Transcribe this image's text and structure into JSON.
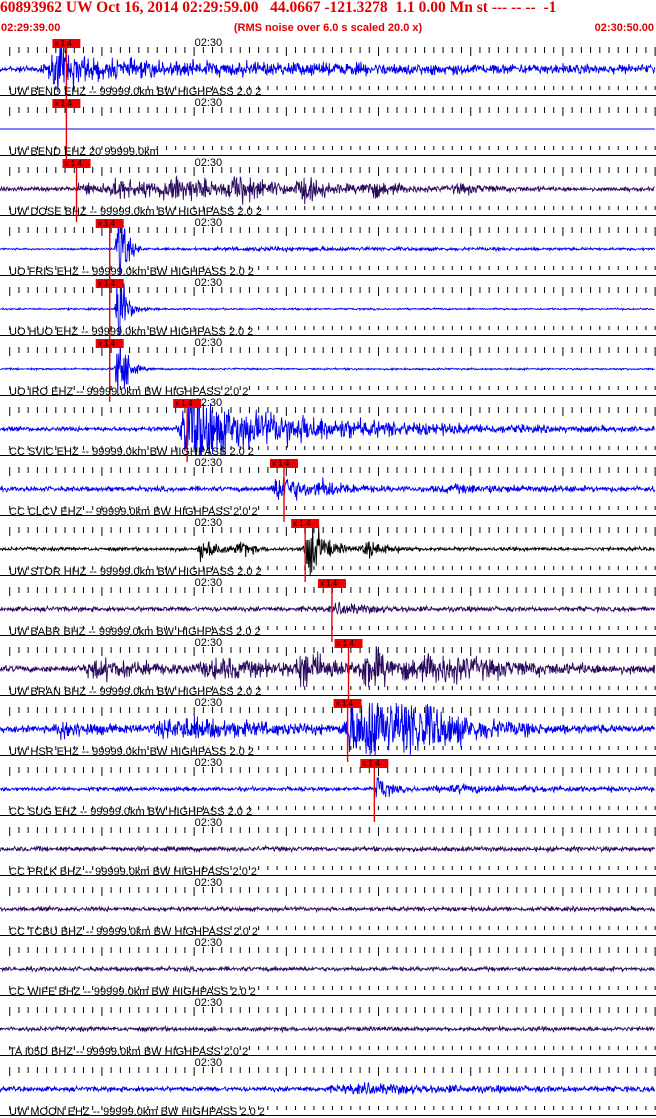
{
  "header": {
    "title": "60893962 UW Oct 16, 2014 02:29:59.00   44.0667 -121.3278  1.1 0.00 Mn st --- -- --  -1",
    "start_time": "02:29:39.00",
    "rms_note": "(RMS noise over 6.0 s scaled 20.0 x)",
    "end_time": "02:30:50.00"
  },
  "colors": {
    "header_red": "#e00000",
    "pick_red": "#ee0000",
    "trace_blue": "#0000ee",
    "trace_purple": "#2a0a5e",
    "trace_black": "#000000"
  },
  "chart_data": {
    "type": "seismogram",
    "x_axis": {
      "unit": "seconds since 02:29:39.00",
      "range": [
        0,
        71
      ],
      "tick_label": "02:30",
      "tick_label_x": 21
    },
    "pick_label": "x 1.4",
    "traces": [
      {
        "label": "UW BEND EHZ -- 99999.0km BW  HIGHPASS  2.0  2",
        "color": "#0000ee",
        "noise": 0.28,
        "pick": 7.2,
        "bursts": [
          [
            6.4,
            3.5,
            1.8
          ],
          [
            20,
            40,
            0.45
          ]
        ]
      },
      {
        "label": "UW BEND EHZ 20 99999.0km",
        "color": "#0000ee",
        "noise": 0,
        "pick": 7.2,
        "bursts": [],
        "flat": true
      },
      {
        "label": "UW DOSE BHZ -- 99999.0km BW  HIGHPASS  2.0  2",
        "color": "#2a0a5e",
        "noise": 0.18,
        "pick": 8.3,
        "bursts": [
          [
            9,
            2,
            0.6
          ],
          [
            13,
            4,
            0.9
          ],
          [
            19,
            6,
            1.0
          ],
          [
            26,
            4,
            0.9
          ],
          [
            33,
            3,
            0.8
          ],
          [
            40,
            3,
            0.7
          ],
          [
            50,
            4,
            0.35
          ]
        ]
      },
      {
        "label": "UO FRIS EHZ -- 99999.0km BW  HIGHPASS  2.0  2",
        "color": "#0000ee",
        "noise": 0.08,
        "pick": 11.9,
        "bursts": [
          [
            12.8,
            0.7,
            6.0
          ],
          [
            30,
            30,
            0.14
          ]
        ]
      },
      {
        "label": "UO HUO EHZ -- 99999.0km BW  HIGHPASS  2.0  2",
        "color": "#0000ee",
        "noise": 0.08,
        "pick": 11.9,
        "bursts": [
          [
            12.8,
            0.7,
            6.0
          ]
        ]
      },
      {
        "label": "UO IRO EHZ -- 99999.0km BW  HIGHPASS  2.0  2",
        "color": "#0000ee",
        "noise": 0.08,
        "pick": 11.9,
        "bursts": [
          [
            12.8,
            0.7,
            6.0
          ]
        ]
      },
      {
        "label": "CC SVIC EHZ -- 99999.0km BW  HIGHPASS  2.0  2",
        "color": "#0000ee",
        "noise": 0.2,
        "pick": 20.3,
        "bursts": [
          [
            20.5,
            2.5,
            4.0
          ],
          [
            23,
            8,
            1.6
          ],
          [
            32,
            16,
            0.7
          ]
        ]
      },
      {
        "label": "CC CLCV EHZ -- 99999.0km BW  HIGHPASS  2.0  2",
        "color": "#0000ee",
        "noise": 0.22,
        "pick": 30.8,
        "bursts": [
          [
            30.4,
            2.5,
            1.5
          ],
          [
            35,
            3,
            0.5
          ],
          [
            50,
            10,
            0.25
          ]
        ]
      },
      {
        "label": "UW STOR HHZ -- 99999.0km BW  HIGHPASS  2.0  2",
        "color": "#000000",
        "noise": 0.16,
        "pick": 33.1,
        "bursts": [
          [
            22,
            1.5,
            1.2
          ],
          [
            26,
            1,
            0.9
          ],
          [
            33.5,
            1.5,
            3.0
          ],
          [
            40,
            2,
            0.7
          ]
        ]
      },
      {
        "label": "UW BABR BHZ -- 99999.0km BW  HIGHPASS  2.0  2",
        "color": "#2a0a5e",
        "noise": 0.22,
        "pick": 36.0,
        "bursts": [
          [
            37,
            4,
            0.4
          ]
        ]
      },
      {
        "label": "UW BRAN BHZ -- 99999.0km BW  HIGHPASS  2.0  2",
        "color": "#2a0a5e",
        "noise": 0.3,
        "pick": 37.8,
        "bursts": [
          [
            11,
            6,
            0.8
          ],
          [
            24,
            8,
            0.7
          ],
          [
            33,
            3,
            1.5
          ],
          [
            40,
            3,
            1.8
          ],
          [
            48,
            10,
            1.0
          ]
        ]
      },
      {
        "label": "UW HSR EHZ -- 99999.0km BW  HIGHPASS  2.0  2",
        "color": "#0000ee",
        "noise": 0.3,
        "pick": 37.7,
        "bursts": [
          [
            7,
            3,
            0.8
          ],
          [
            20,
            10,
            0.9
          ],
          [
            38,
            2,
            2.2
          ],
          [
            40.5,
            5,
            2.6
          ],
          [
            45,
            6,
            1.5
          ]
        ]
      },
      {
        "label": "CC SUG EHZ -- 99999.0km BW  HIGHPASS  2.0  2",
        "color": "#0000ee",
        "noise": 0.18,
        "pick": 40.6,
        "bursts": [
          [
            41,
            1,
            1.4
          ],
          [
            50,
            12,
            0.25
          ]
        ]
      },
      {
        "label": "CC PRLK BHZ -- 99999.0km BW  HIGHPASS  2.0  2",
        "color": "#2a0a5e",
        "noise": 0.22,
        "pick": null,
        "bursts": []
      },
      {
        "label": "CC TCBU BHZ -- 99999.0km BW  HIGHPASS  2.0  2",
        "color": "#2a0a5e",
        "noise": 0.2,
        "pick": null,
        "bursts": []
      },
      {
        "label": "CC WIFE BHZ -- 99999.0km BW  HIGHPASS  2.0  2",
        "color": "#2a0a5e",
        "noise": 0.2,
        "pick": null,
        "bursts": []
      },
      {
        "label": "TA I05D BHZ -- 99999.0km BW  HIGHPASS  2.0  2",
        "color": "#2a0a5e",
        "noise": 0.2,
        "pick": null,
        "bursts": []
      },
      {
        "label": "UW MOON EHZ -- 99999.0km BW  HIGHPASS  2.0  2",
        "color": "#0000ee",
        "noise": 0.22,
        "pick": null,
        "bursts": [
          [
            40,
            12,
            0.35
          ]
        ]
      }
    ]
  }
}
